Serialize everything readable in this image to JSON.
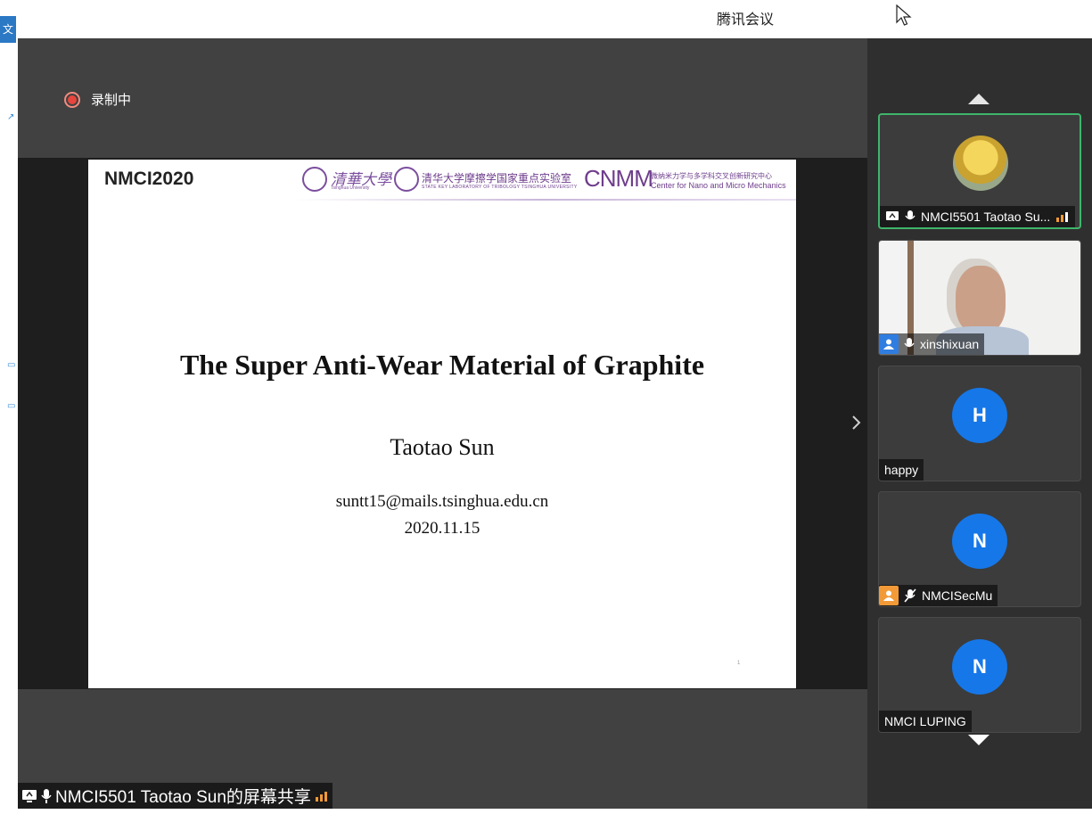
{
  "app": {
    "title": "腾讯会议",
    "left_tab": "文件"
  },
  "recording": {
    "label": "录制中",
    "color": "#e8453c"
  },
  "slide": {
    "logo_text": "NMCI2020",
    "thu_text": "清華大學",
    "thu_sub": "Tsinghua University",
    "lab_text": "清华大学摩擦学国家重点实验室",
    "lab_sub": "STATE KEY LABORATORY OF TRIBOLOGY TSINGHUA UNIVERSITY",
    "cnmm": "CNMM",
    "cnmm_cn": "微纳米力学与多学科交叉创新研究中心",
    "cnmm_en": "Center for Nano and Micro Mechanics",
    "title": "The Super Anti-Wear Material of Graphite",
    "author": "Taotao Sun",
    "email": "suntt15@mails.tsinghua.edu.cn",
    "date": "2020.11.15",
    "page_no": "1"
  },
  "share_status": {
    "text": "NMCI5501 Taotao Sun的屏幕共享"
  },
  "participants": [
    {
      "name": "NMCI5501 Taotao Su...",
      "type": "photo",
      "active": true
    },
    {
      "name": "xinshixuan",
      "type": "video"
    },
    {
      "name": "happy",
      "type": "letter",
      "letter": "H"
    },
    {
      "name": "NMCISecMu",
      "type": "letter",
      "letter": "N",
      "muted": true
    },
    {
      "name": "NMCI LUPING",
      "type": "letter",
      "letter": "N"
    }
  ],
  "colors": {
    "accent": "#1677e8",
    "active_border": "#3fb56b",
    "signal": "#f29a38"
  }
}
